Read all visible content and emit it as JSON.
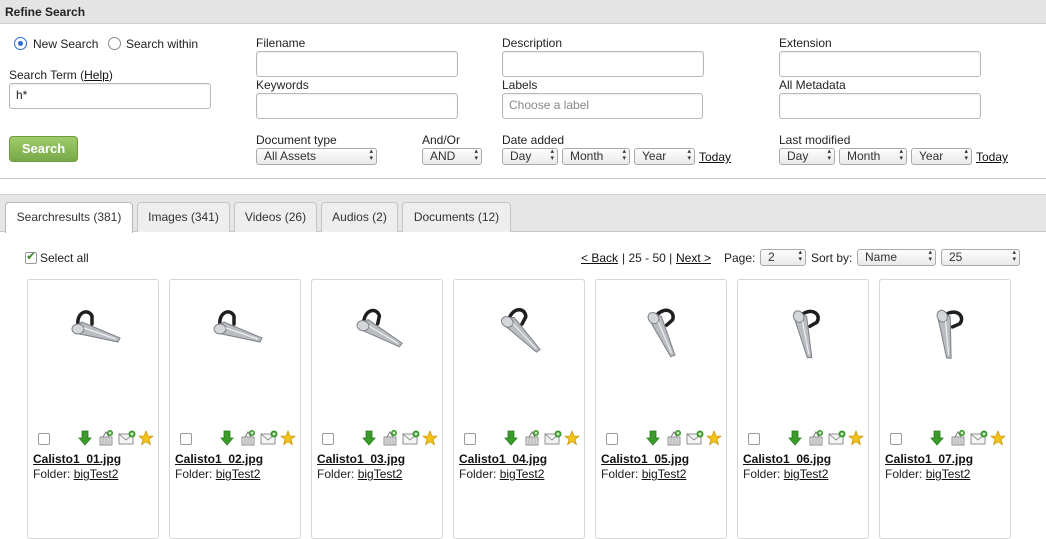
{
  "header": {
    "title": "Refine Search"
  },
  "search_mode": {
    "new_search": "New Search",
    "search_within": "Search within",
    "selected": "new_search"
  },
  "search_term": {
    "label": "Search Term (",
    "help": "Help",
    "label_end": ")",
    "value": "h*"
  },
  "search_button": "Search",
  "fields": {
    "filename": {
      "label": "Filename",
      "value": ""
    },
    "description": {
      "label": "Description",
      "value": ""
    },
    "extension": {
      "label": "Extension",
      "value": ""
    },
    "keywords": {
      "label": "Keywords",
      "value": ""
    },
    "labels": {
      "label": "Labels",
      "placeholder": "Choose a label"
    },
    "all_metadata": {
      "label": "All Metadata",
      "value": ""
    }
  },
  "document_type": {
    "label": "Document type",
    "value": "All Assets"
  },
  "and_or": {
    "label": "And/Or",
    "value": "AND"
  },
  "date_added": {
    "label": "Date added",
    "day": "Day",
    "month": "Month",
    "year": "Year",
    "today": "Today"
  },
  "last_modified": {
    "label": "Last modified",
    "day": "Day",
    "month": "Month",
    "year": "Year",
    "today": "Today"
  },
  "tabs": [
    {
      "label": "Searchresults (381)",
      "active": true
    },
    {
      "label": "Images (341)"
    },
    {
      "label": "Videos (26)"
    },
    {
      "label": "Audios (2)"
    },
    {
      "label": "Documents (12)"
    }
  ],
  "results": {
    "select_all": "Select all",
    "select_all_checked": true,
    "back": "< Back",
    "range": "| 25 - 50 |",
    "next": "Next >",
    "page_label": "Page:",
    "page_value": "2",
    "sort_label": "Sort by:",
    "sort_value": "Name",
    "per_page_value": "25"
  },
  "assets": [
    {
      "name": "Calisto1_01.jpg",
      "folder_label": "Folder:",
      "folder": "bigTest2"
    },
    {
      "name": "Calisto1_02.jpg",
      "folder_label": "Folder:",
      "folder": "bigTest2"
    },
    {
      "name": "Calisto1_03.jpg",
      "folder_label": "Folder:",
      "folder": "bigTest2"
    },
    {
      "name": "Calisto1_04.jpg",
      "folder_label": "Folder:",
      "folder": "bigTest2"
    },
    {
      "name": "Calisto1_05.jpg",
      "folder_label": "Folder:",
      "folder": "bigTest2"
    },
    {
      "name": "Calisto1_06.jpg",
      "folder_label": "Folder:",
      "folder": "bigTest2"
    },
    {
      "name": "Calisto1_07.jpg",
      "folder_label": "Folder:",
      "folder": "bigTest2"
    }
  ],
  "card_action_icons": [
    "download-icon",
    "add-to-basket-icon",
    "email-icon",
    "favorite-star-icon"
  ],
  "colors": {
    "search_button": "#85b553",
    "radio_selected": "#2a6fd6",
    "download_arrow": "#3a9a2a",
    "star": "#f2c21a"
  }
}
